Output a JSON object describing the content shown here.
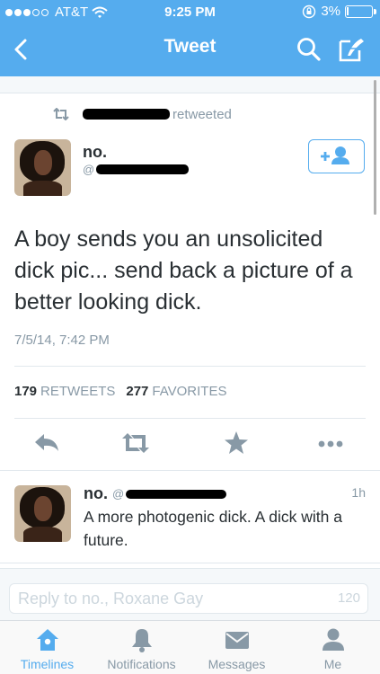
{
  "status_bar": {
    "carrier": "AT&T",
    "time": "9:25 PM",
    "battery": "3%",
    "battery_level": 0.03,
    "icons": [
      "signal-dots",
      "wifi-icon",
      "orientation-lock-icon",
      "battery-icon"
    ]
  },
  "nav": {
    "title": "Tweet",
    "icons": [
      "back-chevron-icon",
      "search-icon",
      "compose-icon"
    ]
  },
  "tweet": {
    "retweet_label": "retweeted",
    "author_name": "no.",
    "handle_prefix": "@",
    "text": "A boy sends you an unsolicited dick pic... send back a picture of a better looking dick.",
    "date": "7/5/14, 7:42 PM",
    "retweets_count": "179",
    "retweets_label": "RETWEETS",
    "favorites_count": "277",
    "favorites_label": "FAVORITES",
    "actions": [
      "reply-icon",
      "retweet-icon",
      "favorite-star-icon",
      "more-icon"
    ]
  },
  "reply": {
    "author_name": "no.",
    "handle_prefix": "@",
    "time": "1h",
    "text": "A more photogenic dick. A dick with a future."
  },
  "composer": {
    "placeholder": "Reply to no., Roxane Gay",
    "char_count": "120"
  },
  "tabs": [
    {
      "label": "Timelines",
      "icon": "home-icon",
      "active": true
    },
    {
      "label": "Notifications",
      "icon": "bell-icon",
      "active": false
    },
    {
      "label": "Messages",
      "icon": "envelope-icon",
      "active": false
    },
    {
      "label": "Me",
      "icon": "person-icon",
      "active": false
    }
  ],
  "colors": {
    "brand_blue": "#55acee",
    "text": "#292f33",
    "secondary": "#8899a6"
  }
}
